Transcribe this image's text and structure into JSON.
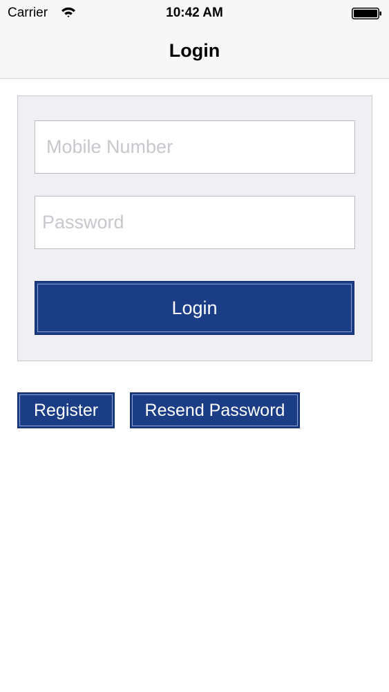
{
  "status_bar": {
    "carrier": "Carrier",
    "time": "10:42 AM",
    "wifi_icon": "wifi-icon",
    "battery_icon": "battery-icon"
  },
  "nav": {
    "title": "Login"
  },
  "login_form": {
    "mobile_placeholder": "Mobile Number",
    "mobile_value": "",
    "password_placeholder": "Password",
    "password_value": "",
    "login_label": "Login"
  },
  "actions": {
    "register_label": "Register",
    "resend_label": "Resend Password"
  },
  "colors": {
    "primary_button": "#1b3d86",
    "panel_background": "#efeff4",
    "bar_background": "#f7f7f7",
    "placeholder_text": "#c7c7cd"
  }
}
